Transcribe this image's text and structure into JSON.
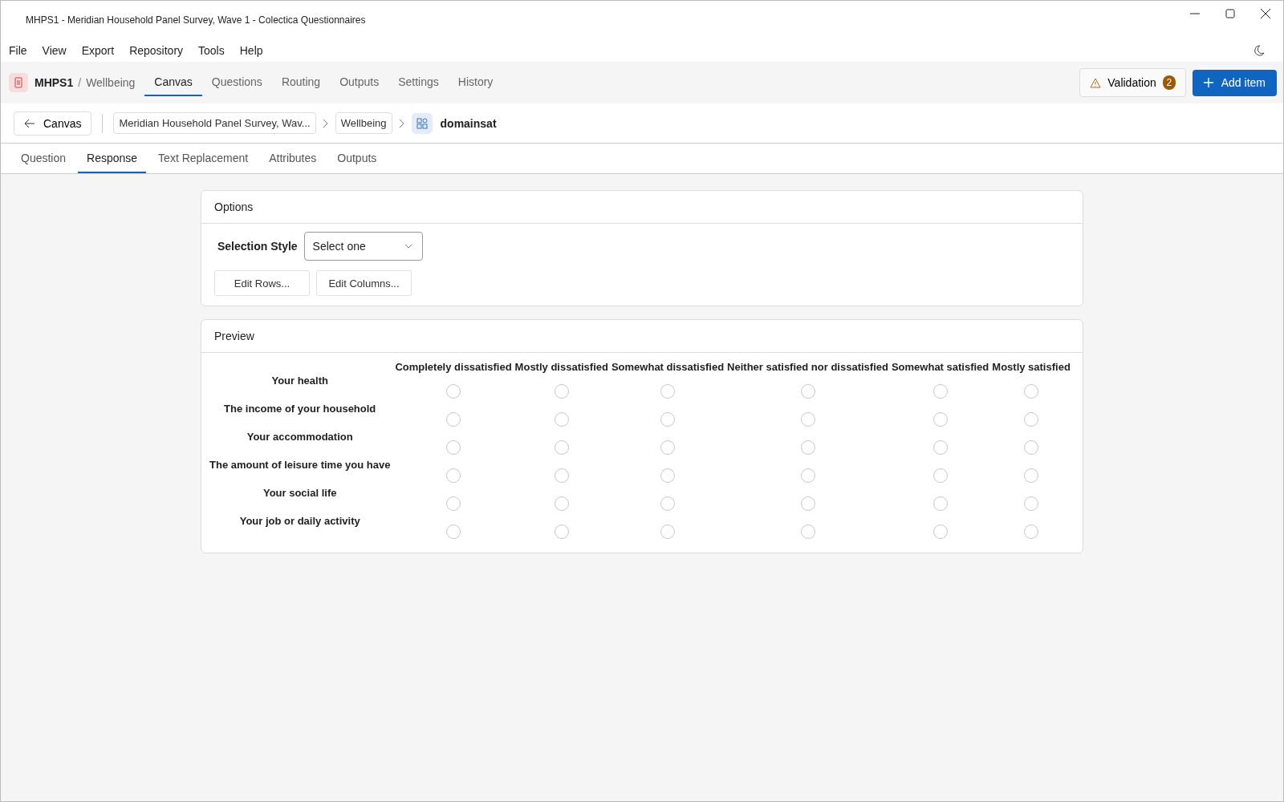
{
  "window": {
    "title": "MHPS1 - Meridian Household Panel Survey, Wave 1 - Colectica Questionnaires"
  },
  "menu": [
    "File",
    "View",
    "Export",
    "Repository",
    "Tools",
    "Help"
  ],
  "toolbar": {
    "project": "MHPS1",
    "separator": "/",
    "section": "Wellbeing",
    "nav": [
      {
        "label": "Canvas",
        "selected": true
      },
      {
        "label": "Questions",
        "selected": false
      },
      {
        "label": "Routing",
        "selected": false
      },
      {
        "label": "Outputs",
        "selected": false
      },
      {
        "label": "Settings",
        "selected": false
      },
      {
        "label": "History",
        "selected": false
      }
    ],
    "validation": {
      "label": "Validation",
      "count": "2"
    },
    "add_button": "Add item"
  },
  "breadcrumb": {
    "back": "Canvas",
    "items": [
      "Meridian Household Panel Survey, Wav...",
      "Wellbeing"
    ],
    "current": "domainsat"
  },
  "tabs": [
    {
      "label": "Question",
      "selected": false
    },
    {
      "label": "Response",
      "selected": true
    },
    {
      "label": "Text Replacement",
      "selected": false
    },
    {
      "label": "Attributes",
      "selected": false
    },
    {
      "label": "Outputs",
      "selected": false
    }
  ],
  "options": {
    "title": "Options",
    "selection_style_label": "Selection Style",
    "selection_style_value": "Select one",
    "buttons": [
      "Edit Rows...",
      "Edit Columns..."
    ]
  },
  "preview": {
    "title": "Preview",
    "columns": [
      "Completely dissatisfied",
      "Mostly dissatisfied",
      "Somewhat dissatisfied",
      "Neither satisfied nor dissatisfied",
      "Somewhat satisfied",
      "Mostly satisfied"
    ],
    "rows": [
      {
        "label": "Your health",
        "options": [
          {
            "selected": false
          },
          {
            "selected": false
          },
          {
            "selected": false
          },
          {
            "selected": false
          },
          {
            "selected": false
          },
          {
            "selected": false
          }
        ]
      },
      {
        "label": "The income of your household",
        "options": [
          {
            "selected": false
          },
          {
            "selected": false
          },
          {
            "selected": false
          },
          {
            "selected": false
          },
          {
            "selected": false
          },
          {
            "selected": false
          }
        ]
      },
      {
        "label": "Your accommodation",
        "options": [
          {
            "selected": false
          },
          {
            "selected": false
          },
          {
            "selected": false
          },
          {
            "selected": false
          },
          {
            "selected": false
          },
          {
            "selected": false
          }
        ]
      },
      {
        "label": "The amount of leisure time you have",
        "options": [
          {
            "selected": false
          },
          {
            "selected": false
          },
          {
            "selected": false
          },
          {
            "selected": false
          },
          {
            "selected": false
          },
          {
            "selected": false
          }
        ]
      },
      {
        "label": "Your social life",
        "options": [
          {
            "selected": false
          },
          {
            "selected": false
          },
          {
            "selected": false
          },
          {
            "selected": false
          },
          {
            "selected": false
          },
          {
            "selected": false
          }
        ]
      },
      {
        "label": "Your job or daily activity",
        "options": [
          {
            "selected": false
          },
          {
            "selected": false
          },
          {
            "selected": false
          },
          {
            "selected": false
          },
          {
            "selected": false
          },
          {
            "selected": false
          }
        ]
      }
    ]
  }
}
